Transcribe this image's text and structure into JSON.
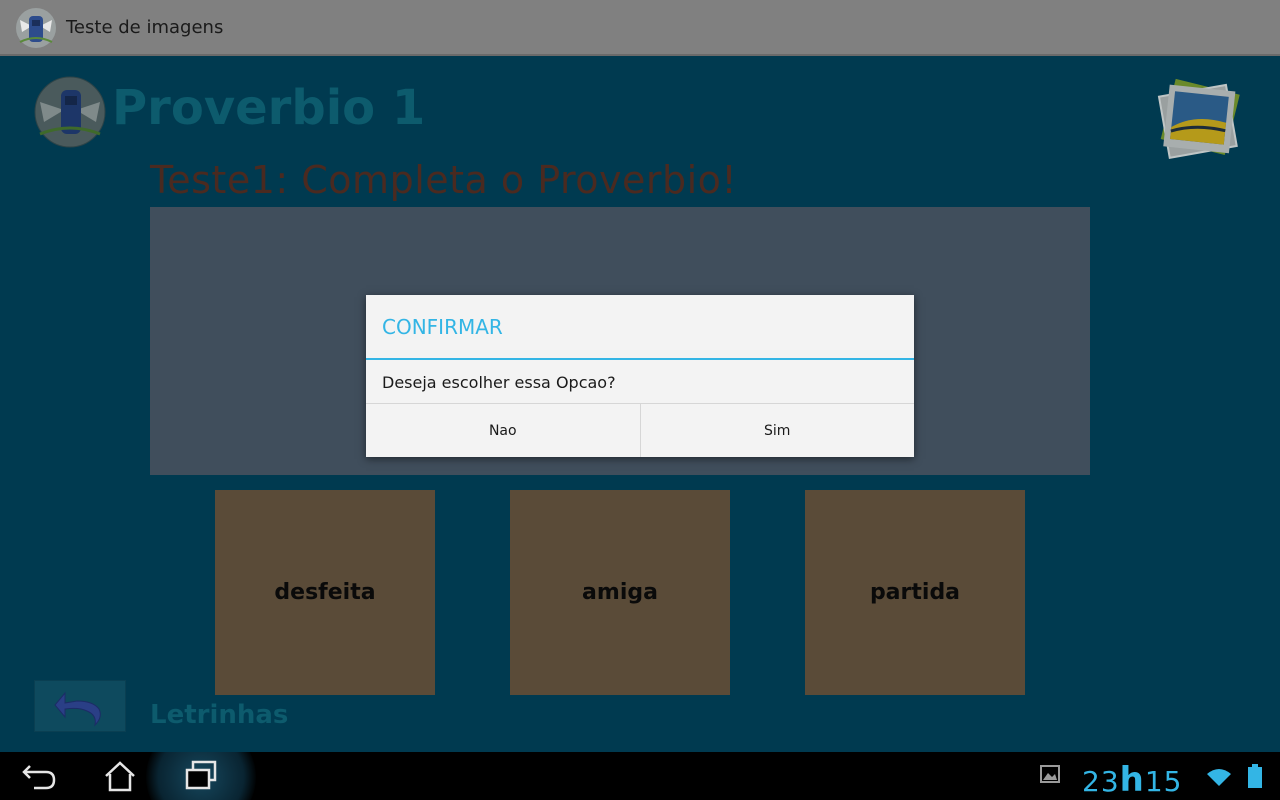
{
  "app": {
    "title": "Teste de imagens"
  },
  "header": {
    "title": "Proverbio 1"
  },
  "quiz": {
    "title": "Teste1: Completa o Proverbio!"
  },
  "options": [
    {
      "label": "desfeita"
    },
    {
      "label": "amiga"
    },
    {
      "label": "partida"
    }
  ],
  "footer": {
    "label": "Letrinhas"
  },
  "dialog": {
    "title": "CONFIRMAR",
    "message": "Deseja escolher essa Opcao?",
    "buttons": [
      {
        "label": "Nao"
      },
      {
        "label": "Sim"
      }
    ]
  },
  "system": {
    "clock_hours": "23",
    "clock_sep": "h",
    "clock_minutes": "15"
  },
  "icons": {
    "app": "app-logo-icon",
    "back": "undo-arrow-icon",
    "gallery": "photo-gallery-icon",
    "nav_back": "back-icon",
    "nav_home": "home-icon",
    "nav_recent": "recent-apps-icon",
    "notification": "image-notification-icon",
    "wifi": "wifi-icon",
    "battery": "battery-icon"
  },
  "colors": {
    "background": "#003a50",
    "accent": "#33b5e5",
    "option_tile": "#5a4b38",
    "dialog": "#f3f3f3"
  }
}
